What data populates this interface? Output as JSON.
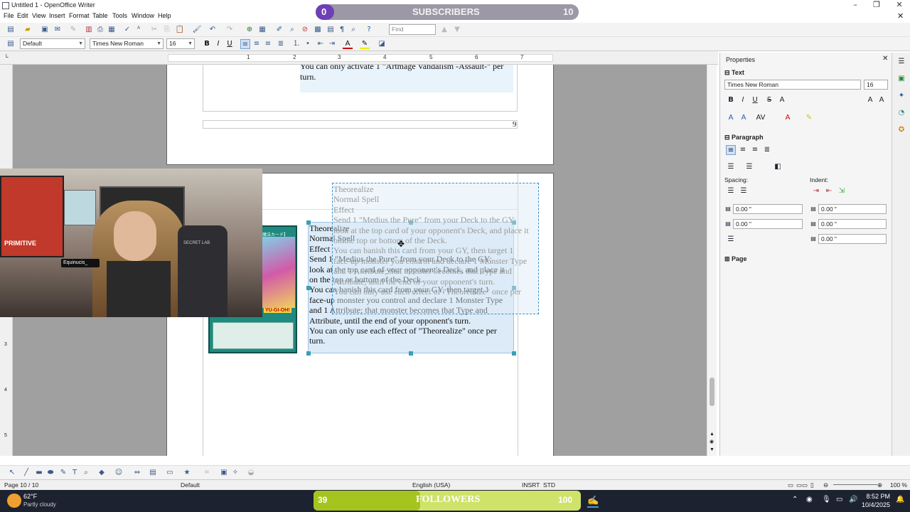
{
  "window": {
    "title": "Untitled 1 - OpenOffice Writer"
  },
  "menu": [
    "File",
    "Edit",
    "View",
    "Insert",
    "Format",
    "Table",
    "Tools",
    "Window",
    "Help"
  ],
  "toolbar": {
    "find_placeholder": "Find"
  },
  "formatting": {
    "style": "Default",
    "font": "Times New Roman",
    "size": "16"
  },
  "ruler_numbers": [
    "1",
    "2",
    "3",
    "4",
    "5",
    "6",
    "7"
  ],
  "vruler_numbers": [
    "3",
    "4",
    "5"
  ],
  "doc": {
    "prev_page_text": "You can only activate 1 \"Artmage Vandalism -Assault-\" per turn.",
    "prev_page_text_l1": "You can only activate 1 \"Artmage Vandalism -Assault-\" per",
    "prev_page_text_l2": "turn.",
    "page_number_field": "9",
    "card_lines": [
      "Theorealize",
      "Normal Spell",
      "Effect",
      "Send 1 \"Medius the Pure\" from your Deck to the GY;",
      "look at the top card of your opponent's Deck, and place it",
      "on the top or bottom of the Deck.",
      "You can banish this card from your GY, then target 1",
      "face-up monster you control and declare 1 Monster Type",
      "and 1 Attribute; that monster becomes that Type and",
      "Attribute, until the end of your opponent's turn.",
      "You can only use each effect of \"Theorealize\" once per",
      "turn."
    ],
    "card_image_top_label": "【魔法カード】",
    "card_image_logo": "YU-GI-OH!"
  },
  "sidebar": {
    "title": "Properties",
    "text_section": "Text",
    "font": "Times New Roman",
    "size": "16",
    "paragraph_section": "Paragraph",
    "spacing_label": "Spacing:",
    "indent_label": "Indent:",
    "spacing_values": [
      "0.00 \"",
      "0.00 \""
    ],
    "indent_values": [
      "0.00 \"",
      "0.00 \"",
      "0.00 \""
    ],
    "page_section": "Page"
  },
  "status": {
    "page": "Page 10 / 10",
    "style": "Default",
    "language": "English (USA)",
    "insert": "INSRT",
    "selection": "STD",
    "zoom": "100 %"
  },
  "taskbar": {
    "temp": "62°F",
    "weather": "Partly cloudy",
    "time": "8:52 PM",
    "date": "10/4/2025"
  },
  "overlays": {
    "subscribers_label": "SUBSCRIBERS",
    "subscribers_current": "0",
    "subscribers_goal": "10",
    "followers_label": "FOLLOWERS",
    "followers_current": "39",
    "followers_goal": "100"
  },
  "webcam": {
    "caption": "Equinucis_",
    "shirt_text": "PRIMITIVE",
    "chair_text": "SECRET LAB"
  }
}
